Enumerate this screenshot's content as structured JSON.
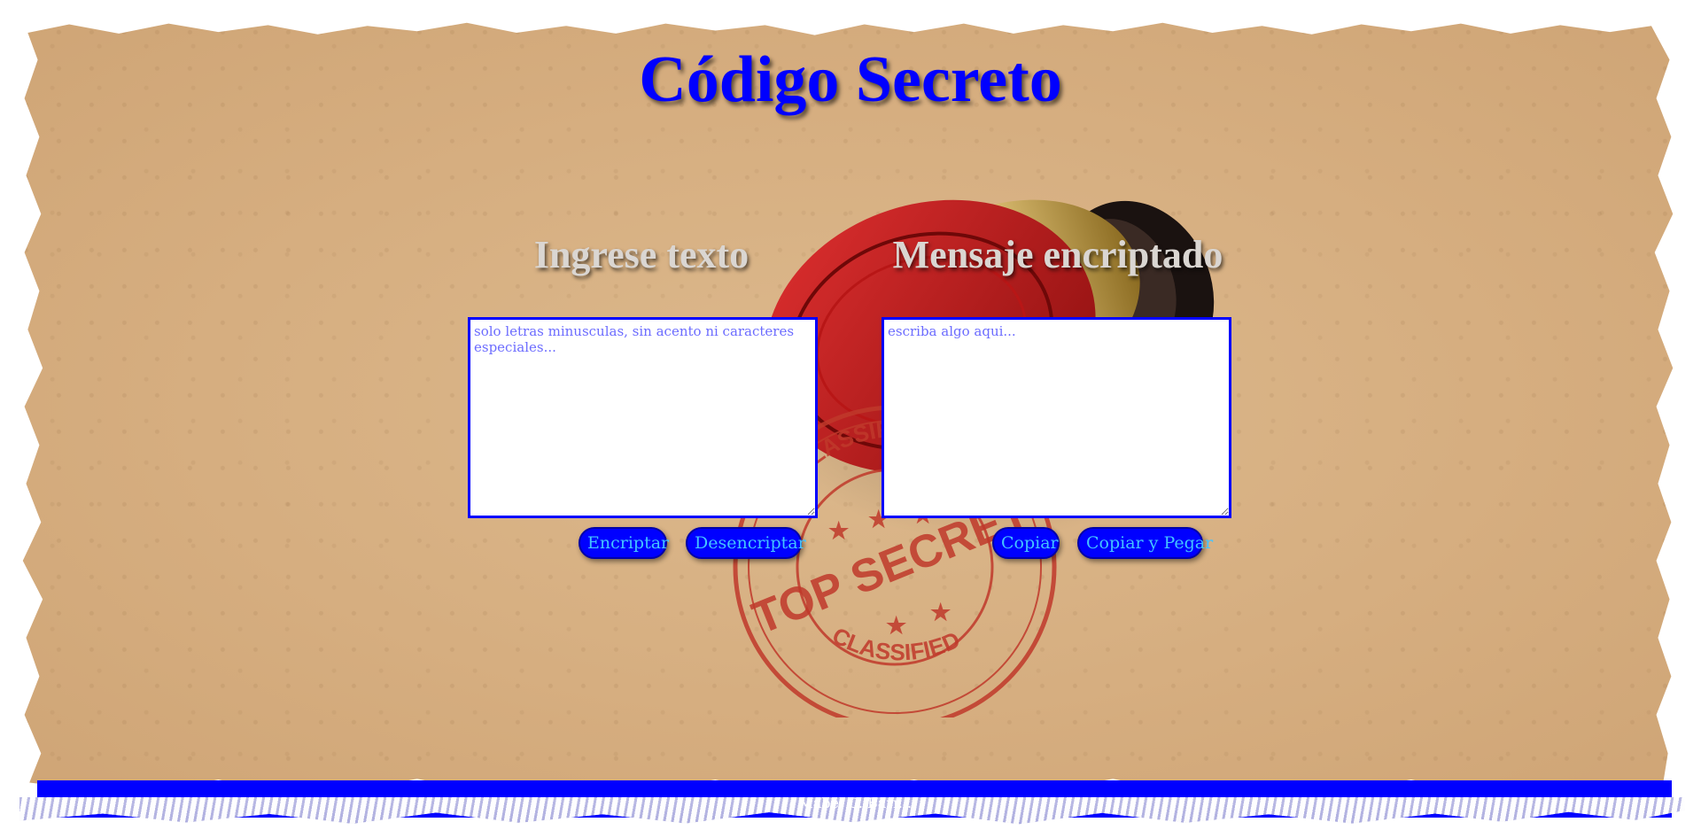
{
  "header": {
    "title": "Código Secreto"
  },
  "left_panel": {
    "heading": "Ingrese texto",
    "input_placeholder": "solo letras minusculas, sin acento ni caracteres especiales...",
    "input_value": ""
  },
  "right_panel": {
    "heading": "Mensaje encriptado",
    "output_placeholder": "escriba algo aqui...",
    "output_value": ""
  },
  "buttons": {
    "encrypt_label": "Encriptar",
    "decrypt_label": "Desencriptar",
    "copy_label": "Copiar",
    "copy_paste_label": "Copiar y Pegar"
  },
  "decor": {
    "stamp_top_text": "CLASSIFIED",
    "stamp_center_text": "TOP SECRET",
    "stamp_bottom_text": "CLASSIFIED"
  },
  "footer": {
    "credit": "- Mabel C. Barr..."
  },
  "colors": {
    "accent": "#0000ff",
    "button_text": "#44c4ff",
    "heading": "#dad6d2",
    "paper": "#d6ae80",
    "stamp_ink": "#c0392b"
  }
}
